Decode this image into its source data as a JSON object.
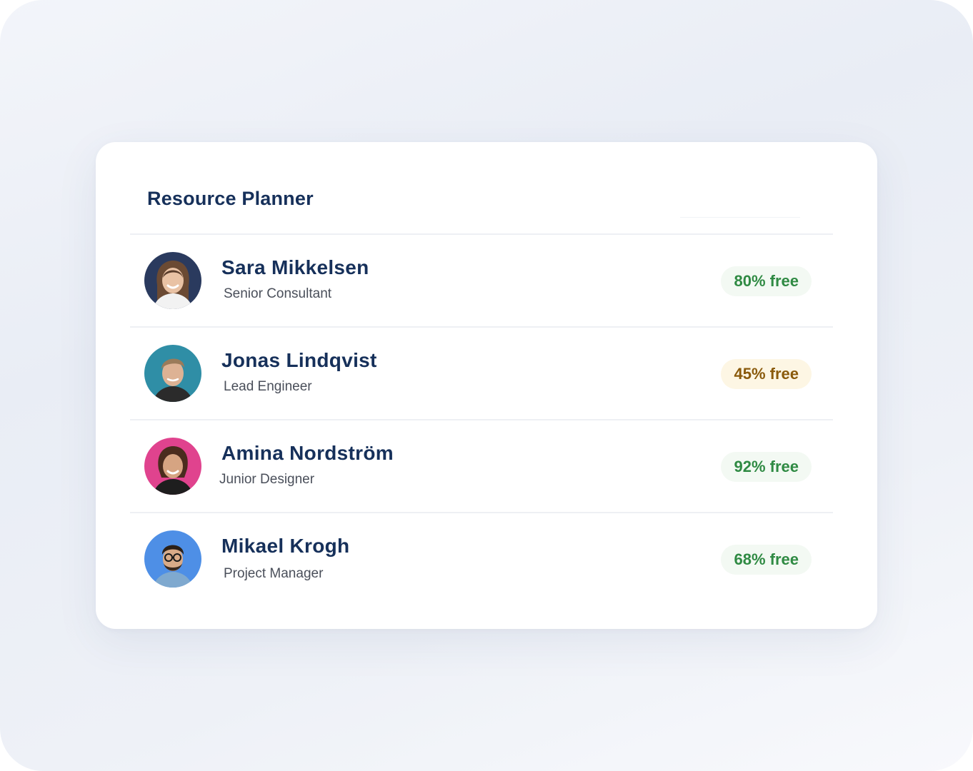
{
  "panel": {
    "title": "Resource Planner"
  },
  "people": [
    {
      "name": "Sara Mikkelsen",
      "role": "Senior Consultant",
      "availability": "80% free",
      "status": "green",
      "avatar_bg": "#2a3a5e"
    },
    {
      "name": "Jonas Lindqvist",
      "role": "Lead Engineer",
      "availability": "45% free",
      "status": "amber",
      "avatar_bg": "#2f8ea6"
    },
    {
      "name": "Amina Nordström",
      "role": "Junior Designer",
      "availability": "92% free",
      "status": "green",
      "avatar_bg": "#e0438e"
    },
    {
      "name": "Mikael Krogh",
      "role": "Project Manager",
      "availability": "68% free",
      "status": "green",
      "avatar_bg": "#4e8fe6"
    }
  ],
  "colors": {
    "title": "#16305a",
    "free_high": "#2f8a43",
    "free_mid": "#8a5a0b"
  }
}
